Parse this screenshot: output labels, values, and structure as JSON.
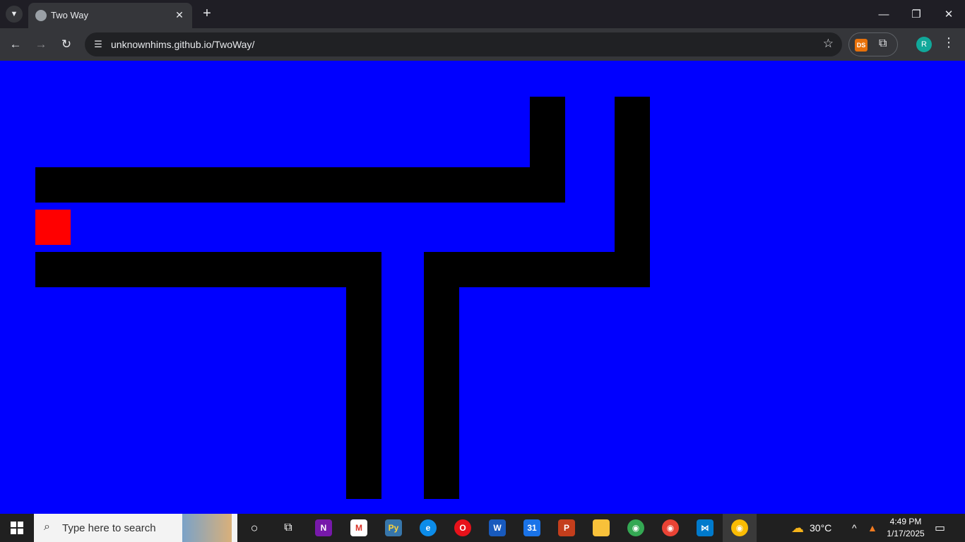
{
  "browser": {
    "tab_title": "Two Way",
    "url": "unknownhims.github.io/TwoWay/",
    "profile_initial": "R",
    "extension_label": "DS"
  },
  "game": {
    "background_color": "#0000ff",
    "wall_color": "#000000",
    "player_color": "#ff0000"
  },
  "taskbar": {
    "search_placeholder": "Type here to search",
    "weather": "30°C",
    "time": "4:49 PM",
    "date": "1/17/2025",
    "calendar_day": "31"
  }
}
